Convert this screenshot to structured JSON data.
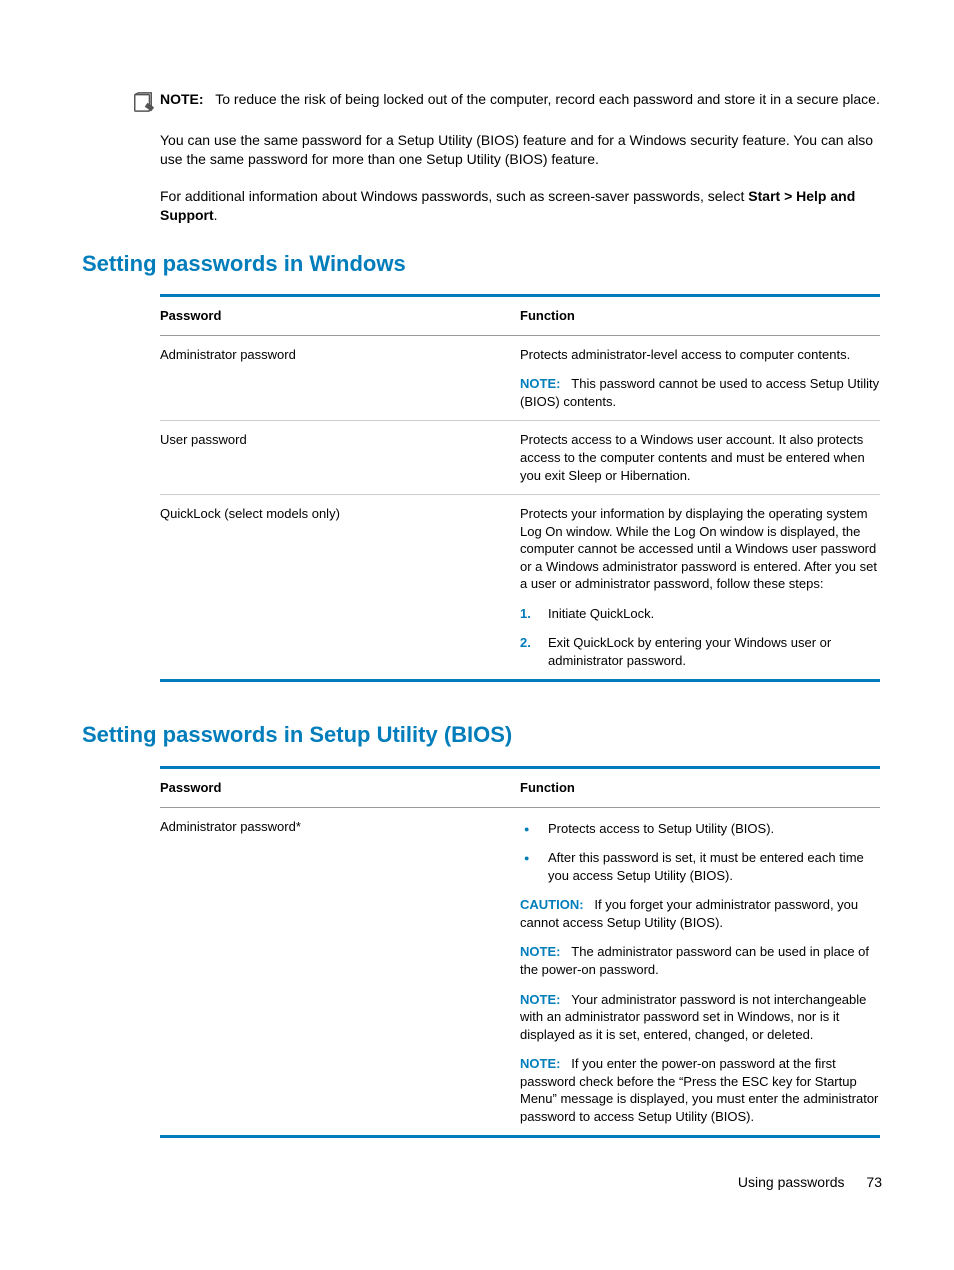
{
  "top_note": {
    "label": "NOTE:",
    "text": "To reduce the risk of being locked out of the computer, record each password and store it in a secure place."
  },
  "para1": "You can use the same password for a Setup Utility (BIOS) feature and for a Windows security feature. You can also use the same password for more than one Setup Utility (BIOS) feature.",
  "para2_pre": "For additional information about Windows passwords, such as screen-saver passwords, select ",
  "para2_bold": "Start > Help and Support",
  "para2_post": ".",
  "heading1": "Setting passwords in Windows",
  "table1": {
    "h1": "Password",
    "h2": "Function",
    "rows": [
      {
        "name": "Administrator password",
        "desc": "Protects administrator-level access to computer contents.",
        "note_label": "NOTE:",
        "note_text": "This password cannot be used to access Setup Utility (BIOS) contents."
      },
      {
        "name": "User password",
        "desc": "Protects access to a Windows user account. It also protects access to the computer contents and must be entered when you exit Sleep or Hibernation."
      },
      {
        "name": "QuickLock (select models only)",
        "desc": "Protects your information by displaying the operating system Log On window. While the Log On window is displayed, the computer cannot be accessed until a Windows user password or a Windows administrator password is entered. After you set a user or administrator password, follow these steps:",
        "steps": [
          "Initiate QuickLock.",
          "Exit QuickLock by entering your Windows user or administrator password."
        ]
      }
    ]
  },
  "heading2": "Setting passwords in Setup Utility (BIOS)",
  "table2": {
    "h1": "Password",
    "h2": "Function",
    "row": {
      "name": "Administrator password*",
      "bullets": [
        "Protects access to Setup Utility (BIOS).",
        "After this password is set, it must be entered each time you access Setup Utility (BIOS)."
      ],
      "caution_label": "CAUTION:",
      "caution_text": "If you forget your administrator password, you cannot access Setup Utility (BIOS).",
      "note1_label": "NOTE:",
      "note1_text": "The administrator password can be used in place of the power-on password.",
      "note2_label": "NOTE:",
      "note2_text": "Your administrator password is not interchangeable with an administrator password set in Windows, nor is it displayed as it is set, entered, changed, or deleted.",
      "note3_label": "NOTE:",
      "note3_text": "If you enter the power-on password at the first password check before the “Press the ESC key for Startup Menu” message is displayed, you must enter the administrator password to access Setup Utility (BIOS)."
    }
  },
  "footer": {
    "section": "Using passwords",
    "page": "73"
  }
}
